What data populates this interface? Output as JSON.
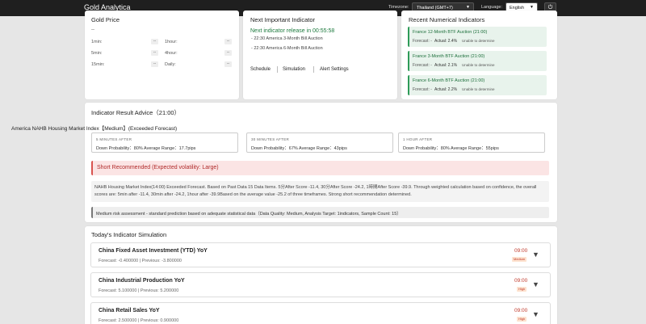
{
  "header": {
    "brand": "Gold Analytica",
    "timezone_label": "Timezone:",
    "timezone_value": "Thailand (GMT+7)",
    "language_label": "Language:",
    "language_value": "English",
    "power_icon": "⏻"
  },
  "gold_price": {
    "title": "Gold Price",
    "value": "--",
    "rows": [
      {
        "label": "1min:",
        "value": "--"
      },
      {
        "label": "5min:",
        "value": "--"
      },
      {
        "label": "15min:",
        "value": "--"
      },
      {
        "label": "1hour:",
        "value": "--"
      },
      {
        "label": "4hour:",
        "value": "--"
      },
      {
        "label": "Daily:",
        "value": "--"
      }
    ]
  },
  "next_indicator": {
    "title": "Next Important Indicator",
    "release_text": "Next indicator release in 00:55:58",
    "items": [
      "- 22:30 America 3-Month Bill Auction",
      "- 22:30 America 6-Month Bill Auction"
    ],
    "links": [
      "Schedule",
      "Simulation",
      "Alert Settings"
    ]
  },
  "recent": {
    "title": "Recent Numerical Indicators",
    "items": [
      {
        "title": "France 12-Month BTF Auction (21:00)",
        "forecast": "Forecast: -",
        "actual": "Actual: 2.4%",
        "verdict": "Unable to determine"
      },
      {
        "title": "France 3-Month BTF Auction (21:00)",
        "forecast": "Forecast: -",
        "actual": "Actual: 2.1%",
        "verdict": "Unable to determine"
      },
      {
        "title": "France 6-Month BTF Auction (21:00)",
        "forecast": "Forecast: -",
        "actual": "Actual: 2.2%",
        "verdict": "Unable to determine"
      }
    ]
  },
  "advice": {
    "title": "Indicator Result Advice（21:00）",
    "indicator_title": "America NAHB Housing Market Index【Medium】(Exceeded Forecast)",
    "windows": [
      {
        "title": "5 MINUTES AFTER",
        "body": "Down Probability：80% Average Range：17.7pips"
      },
      {
        "title": "30 MINUTES AFTER",
        "body": "Down Probability：67% Average Range：43pips"
      },
      {
        "title": "1 HOUR AFTER",
        "body": "Down Probability：80% Average Range：55pips"
      }
    ],
    "recommendation": "Short Recommended (Expected volatility: Large)",
    "analysis": "NAHB Housing Market Index(14:00) Exceeded Forecast. Based on Past Data 15 Data Items. 5分After Score -11.4, 30分After Score -24.2, 1時間After Score -39.9. Through weighted calculation based on confidence, the overall scores are: 5min after -11.4, 30min after -24.2, 1hour after -39.9Based on the average value -25.2 of three timeframes. Strong short recommendation determined.",
    "risk": "Medium risk assessment - standard prediction based on adequate statistical data（Data Quality: Medium, Analysis Target: 1indicators, Sample Count: 15）"
  },
  "simulation": {
    "title": "Today's Indicator Simulation",
    "items": [
      {
        "name": "China Fixed Asset Investment (YTD) YoY",
        "sub": "Forecast: -0.400000 | Previous: -3.800000",
        "time": "09:00",
        "badge": "Medium"
      },
      {
        "name": "China Industrial Production YoY",
        "sub": "Forecast: 5.100000 | Previous: 5.200000",
        "time": "09:00",
        "badge": "High"
      },
      {
        "name": "China Retail Sales YoY",
        "sub": "Forecast: 2.500000 | Previous: 0.900000",
        "time": "09:00",
        "badge": "High"
      }
    ]
  }
}
